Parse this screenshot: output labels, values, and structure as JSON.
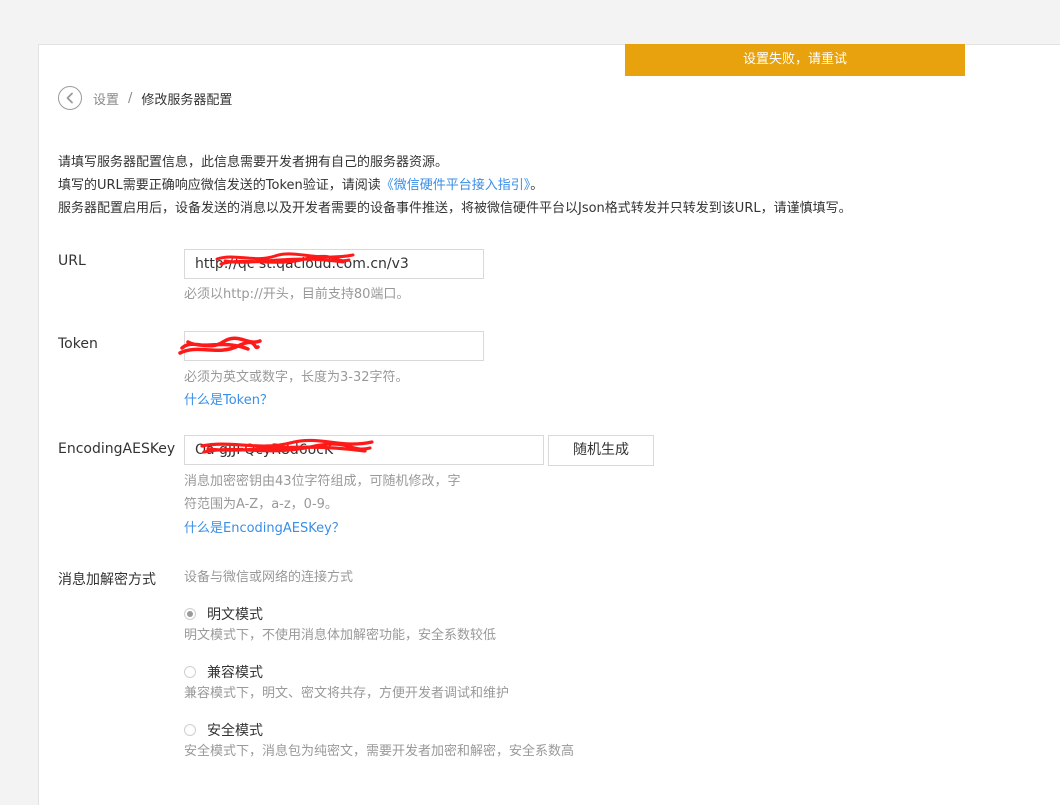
{
  "toast": {
    "message": "设置失败，请重试",
    "color": "#e8a20d"
  },
  "breadcrumb": {
    "parent": "设置",
    "separator": "/",
    "current": "修改服务器配置"
  },
  "intro": {
    "line1": "请填写服务器配置信息，此信息需要开发者拥有自己的服务器资源。",
    "line2_prefix": "填写的URL需要正确响应微信发送的Token验证，请阅读",
    "line2_link": "《微信硬件平台接入指引》",
    "line2_suffix": "。",
    "line3": "服务器配置启用后，设备发送的消息以及开发者需要的设备事件推送，将被微信硬件平台以Json格式转发并只转发到该URL，请谨慎填写。"
  },
  "url_field": {
    "label": "URL",
    "value": "http://qc         st.qacloud.com.cn/v3",
    "hint": "必须以http://开头，目前支持80端口。"
  },
  "token_field": {
    "label": "Token",
    "value": "",
    "hint": "必须为英文或数字，长度为3-32字符。",
    "help_link": "什么是Token？"
  },
  "aeskey_field": {
    "label": "EncodingAESKey",
    "value": "Oa                   gJJFQcyR8d6ocK",
    "generate_button": "随机生成",
    "hint_line1": "消息加密密钥由43位字符组成，可随机修改，字",
    "hint_line2": "符范围为A-Z，a-z，0-9。",
    "help_link": "什么是EncodingAESKey？"
  },
  "encryption": {
    "label": "消息加解密方式",
    "description": "设备与微信或网络的连接方式",
    "options": [
      {
        "label": "明文模式",
        "desc": "明文模式下，不使用消息体加解密功能，安全系数较低",
        "selected": true
      },
      {
        "label": "兼容模式",
        "desc": "兼容模式下，明文、密文将共存，方便开发者调试和维护",
        "selected": false
      },
      {
        "label": "安全模式",
        "desc": "安全模式下，消息包为纯密文，需要开发者加密和解密，安全系数高",
        "selected": false
      }
    ]
  },
  "colors": {
    "accent_link": "#3a8ee6",
    "redaction": "#ff1a1a"
  }
}
